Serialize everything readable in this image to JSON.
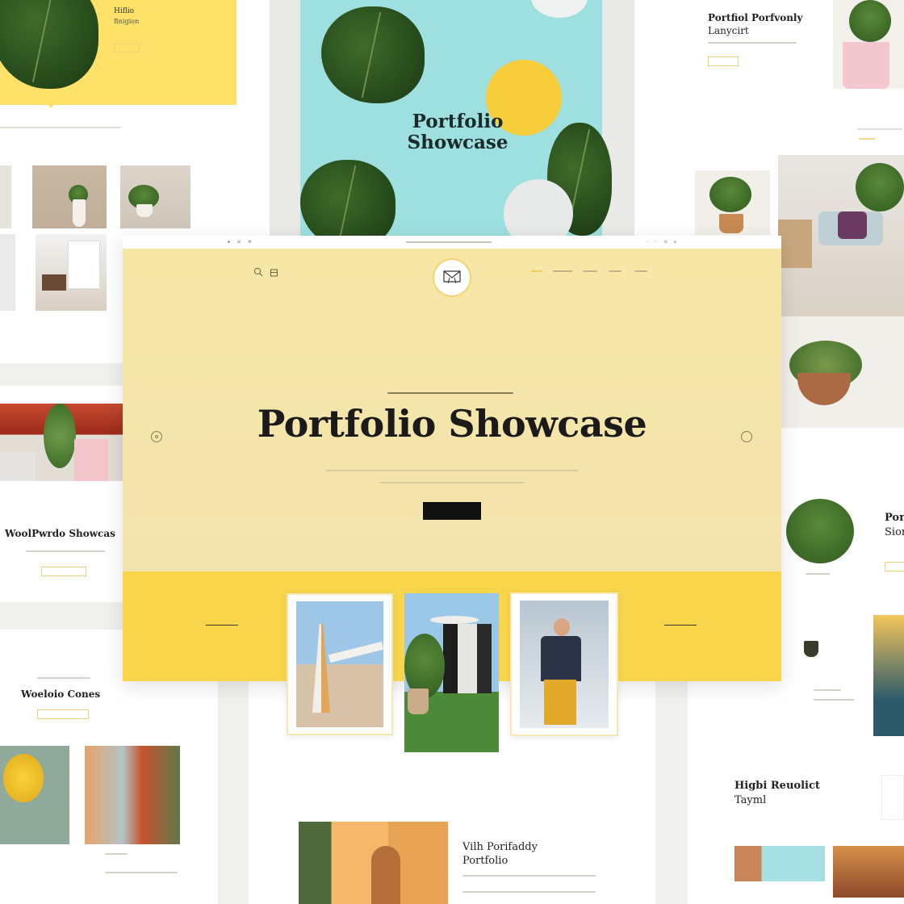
{
  "colors": {
    "accent_yellow": "#f9d54b",
    "pale_yellow": "#f5e6a8",
    "aqua": "#9edfe0",
    "dark": "#1b1b1b"
  },
  "bg_top_left": {
    "title_line1": "Hiflio",
    "title_line2": "Bnigion"
  },
  "bg_top_center": {
    "title": "Portfolio Showcase"
  },
  "bg_top_right": {
    "title_line1": "Portfiol Porfvonly",
    "title_line2": "Lanycirt"
  },
  "bg_left_mid": {
    "title": "WoolPwrdo Showcas"
  },
  "bg_left_low": {
    "title": "Woeloio Cones"
  },
  "bg_right_mid": {
    "title_line1": "Por",
    "title_line2": "Sior"
  },
  "bg_right_low": {
    "title_line1": "Higbi Reuolict",
    "title_line2": "Tayml"
  },
  "bg_bottom_center": {
    "title_line1": "Vilh Porifaddy",
    "title_line2": "Portfolio"
  },
  "main_window": {
    "hero": {
      "title": "Portfolio Showcase"
    },
    "icons": {
      "search": "search-icon",
      "bag": "bag-icon",
      "logo": "envelope-logo-icon",
      "prev": "circle-prev-icon",
      "next": "circle-next-icon"
    }
  }
}
